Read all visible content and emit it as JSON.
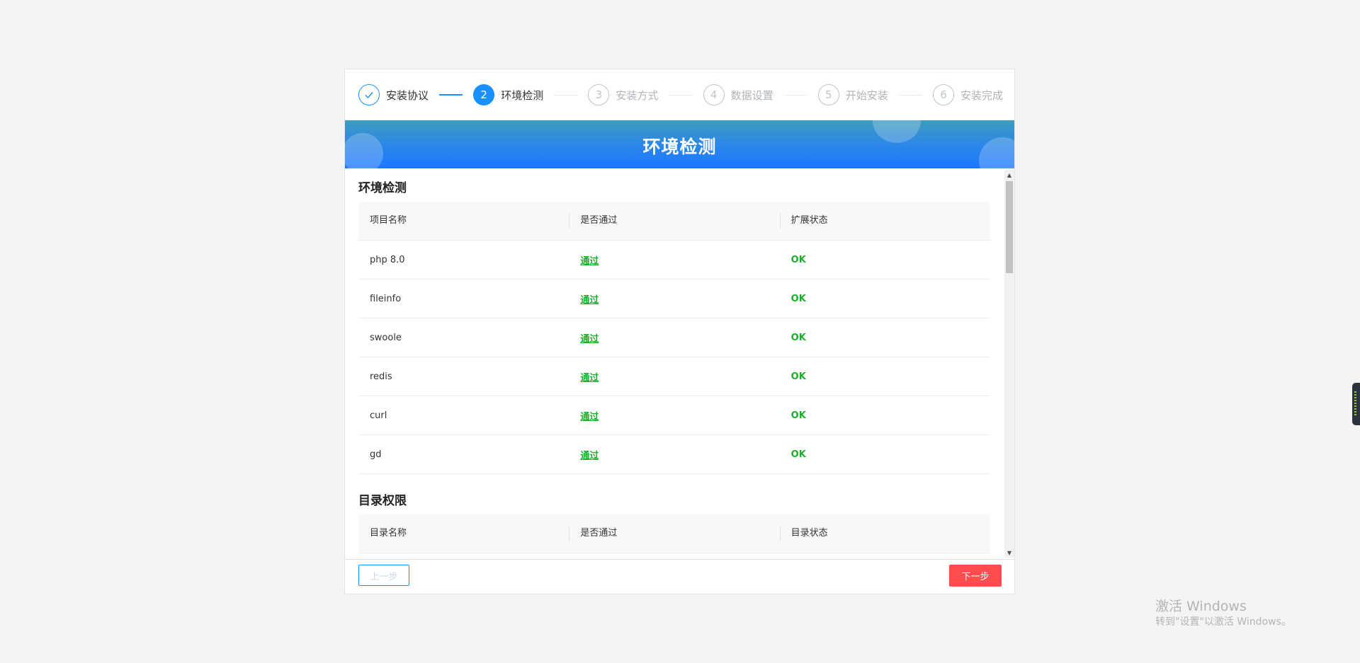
{
  "steps": [
    {
      "number": "✓",
      "label": "安装协议",
      "state": "done"
    },
    {
      "number": "2",
      "label": "环境检测",
      "state": "active"
    },
    {
      "number": "3",
      "label": "安装方式",
      "state": "pending"
    },
    {
      "number": "4",
      "label": "数据设置",
      "state": "pending"
    },
    {
      "number": "5",
      "label": "开始安装",
      "state": "pending"
    },
    {
      "number": "6",
      "label": "安装完成",
      "state": "pending"
    }
  ],
  "banner": {
    "title": "环境检测"
  },
  "env_section": {
    "title": "环境检测",
    "headers": [
      "项目名称",
      "是否通过",
      "扩展状态"
    ],
    "rows": [
      {
        "name": "php 8.0",
        "pass": "通过",
        "status": "OK"
      },
      {
        "name": "fileinfo",
        "pass": "通过",
        "status": "OK"
      },
      {
        "name": "swoole",
        "pass": "通过",
        "status": "OK"
      },
      {
        "name": "redis",
        "pass": "通过",
        "status": "OK"
      },
      {
        "name": "curl",
        "pass": "通过",
        "status": "OK"
      },
      {
        "name": "gd",
        "pass": "通过",
        "status": "OK"
      }
    ]
  },
  "dir_section": {
    "title": "目录权限",
    "headers": [
      "目录名称",
      "是否通过",
      "目录状态"
    ]
  },
  "footer": {
    "prev_label": "上一步",
    "next_label": "下一步"
  },
  "watermark": {
    "title": "激活 Windows",
    "subtitle": "转到\"设置\"以激活 Windows。"
  },
  "colors": {
    "accent": "#1890ff",
    "pass": "#18b028",
    "next_button": "#ff4d4f"
  }
}
